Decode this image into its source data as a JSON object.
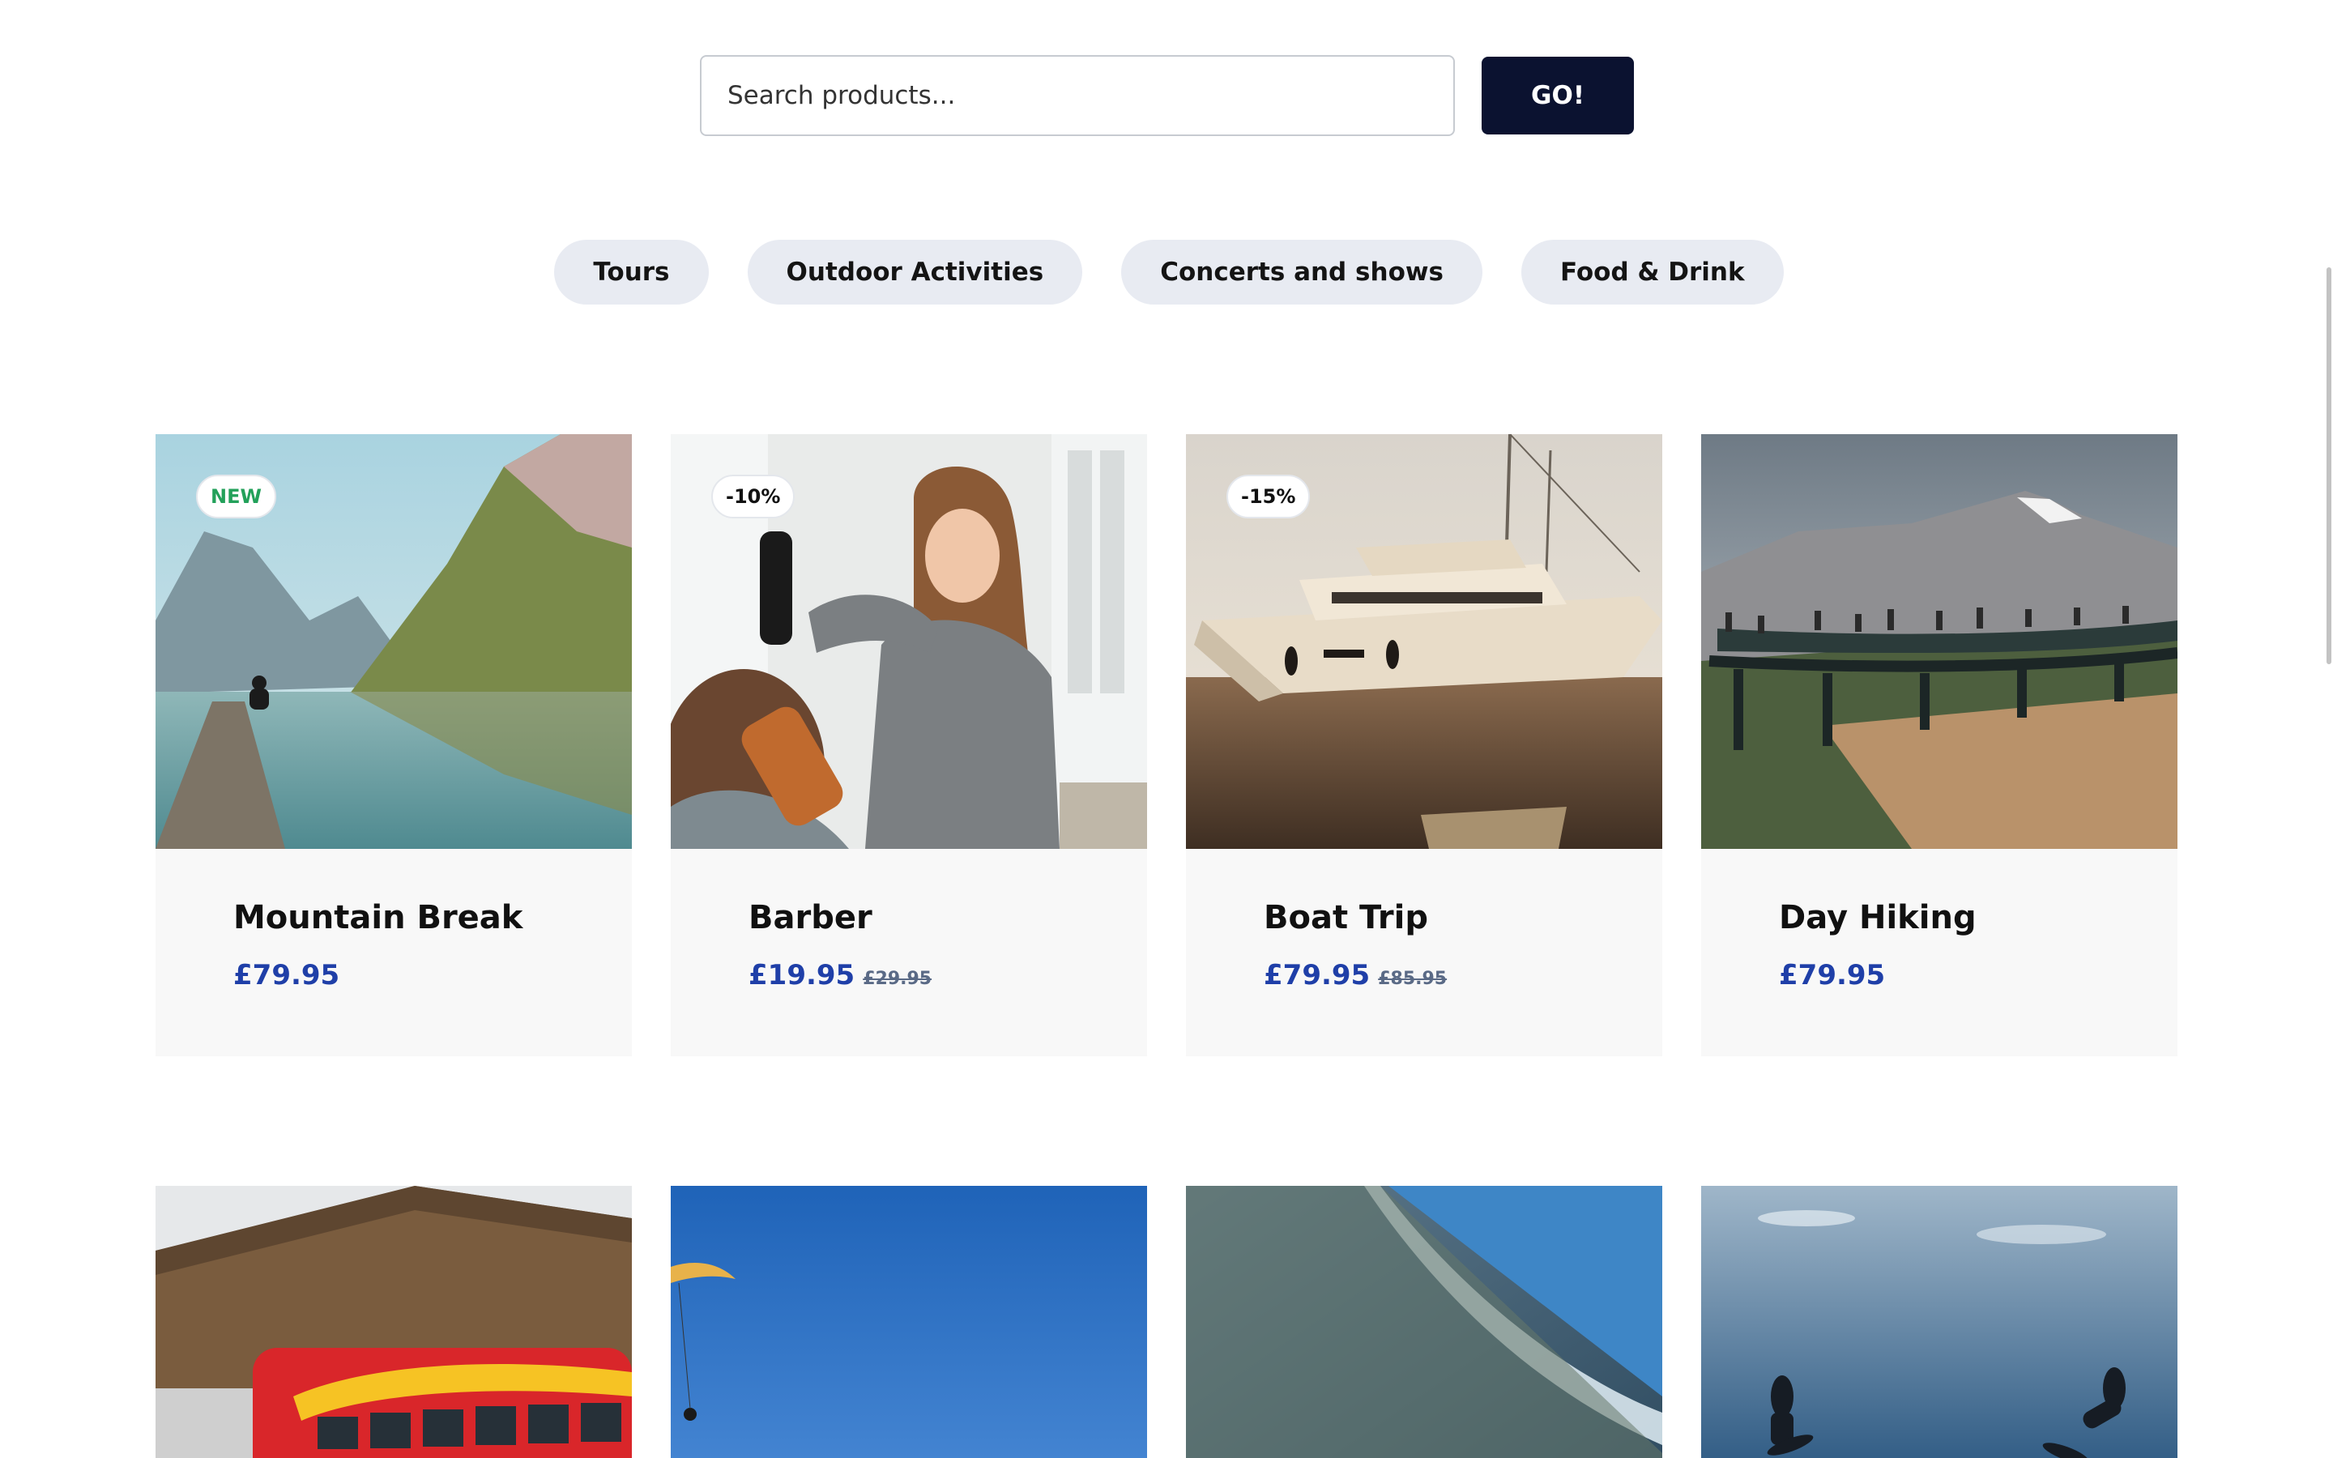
{
  "search": {
    "placeholder": "Search products...",
    "button_label": "GO!"
  },
  "categories": [
    "Tours",
    "Outdoor Activities",
    "Concerts and shows",
    "Food & Drink"
  ],
  "products": [
    {
      "title": "Mountain Break",
      "price": "£79.95",
      "old_price": "",
      "badge": "NEW"
    },
    {
      "title": "Barber",
      "price": "£19.95",
      "old_price": "£29.95",
      "badge": "-10%"
    },
    {
      "title": "Boat Trip",
      "price": "£79.95",
      "old_price": "£85.95",
      "badge": "-15%"
    },
    {
      "title": "Day Hiking",
      "price": "£79.95",
      "old_price": "",
      "badge": ""
    }
  ],
  "colors": {
    "accent": "#0b1230",
    "price": "#1f3fa8",
    "new_badge": "#23a15a",
    "pill_bg": "#e8ebf2"
  }
}
